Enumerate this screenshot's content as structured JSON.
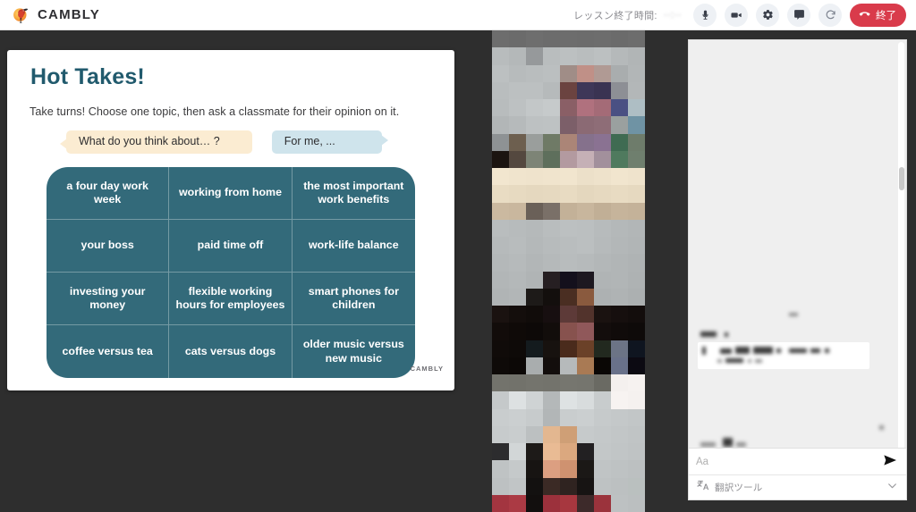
{
  "topbar": {
    "brand_name": "CAMBLY",
    "brand_logo_icon": "cambly-dodo-bird-logo",
    "lesson_timer_label": "レッスン終了時間:",
    "lesson_timer_value": "··:··",
    "controls": [
      {
        "name": "microphone-button",
        "icon": "microphone-icon"
      },
      {
        "name": "video-camera-button",
        "icon": "video-camera-icon"
      },
      {
        "name": "settings-button",
        "icon": "gear-icon"
      },
      {
        "name": "chat-toggle-button",
        "icon": "chat-bubble-icon"
      },
      {
        "name": "reload-button",
        "icon": "refresh-icon"
      }
    ],
    "end_call": {
      "label": "終了",
      "icon": "phone-hangup-icon",
      "color": "#d93b4b"
    }
  },
  "slide": {
    "title": "Hot Takes!",
    "title_color": "#215a6d",
    "subtitle": "Take turns! Choose one topic, then ask a classmate for their opinion on it.",
    "bubbles": [
      {
        "text": "What do you think about… ?",
        "color": "#fbecd2",
        "tail": "left"
      },
      {
        "text": "For me, ...",
        "color": "#cfe4ec",
        "tail": "right"
      }
    ],
    "grid_color": "#336a7a",
    "topics": [
      "a four day work week",
      "working from home",
      "the most important work benefits",
      "your boss",
      "paid time off",
      "work-life balance",
      "investing your money",
      "flexible working hours for employees",
      "smart phones for children",
      "coffee versus tea",
      "cats versus dogs",
      "older music versus new music"
    ],
    "watermark": "CAMBLY"
  },
  "video": {
    "name": "participant-video-feed",
    "state": "pixelated"
  },
  "chat": {
    "messages_state": "redacted",
    "input_placeholder": "Aa",
    "input_value": "",
    "send_icon": "send-arrow-icon",
    "translate_label": "翻訳ツール",
    "translate_icon": "translate-icon",
    "translate_chevron_icon": "chevron-down-icon"
  }
}
